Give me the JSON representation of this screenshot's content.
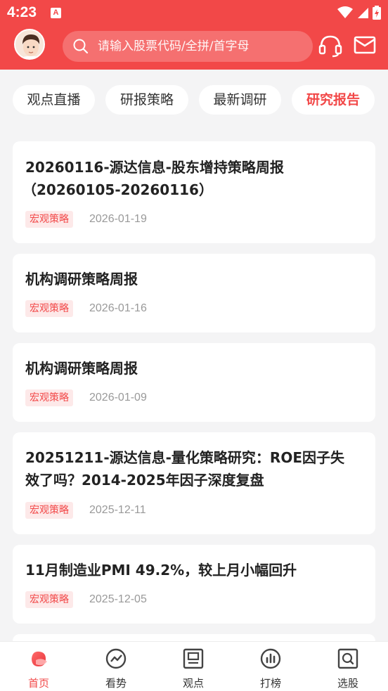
{
  "status_bar": {
    "time": "4:23",
    "notif_badge": "A"
  },
  "header": {
    "search_placeholder": "请输入股票代码/全拼/首字母",
    "icons": [
      "user-avatar",
      "search-icon",
      "headset-icon",
      "mail-icon"
    ]
  },
  "tabs": [
    {
      "label": "观点直播",
      "active": false
    },
    {
      "label": "研报策略",
      "active": false
    },
    {
      "label": "最新调研",
      "active": false
    },
    {
      "label": "研究报告",
      "active": true
    }
  ],
  "reports": [
    {
      "title_line1": "20260116-源达信息-股东增持策略周报",
      "title_line2": "（20260105-20260116）",
      "tag": "宏观策略",
      "date": "2026-01-19"
    },
    {
      "title_line1": "机构调研策略周报",
      "tag": "宏观策略",
      "date": "2026-01-16"
    },
    {
      "title_line1": "机构调研策略周报",
      "tag": "宏观策略",
      "date": "2026-01-09"
    },
    {
      "title_line1": "20251211-源达信息-量化策略研究：ROE因子失",
      "title_line2": "效了吗？2014-2025年因子深度复盘",
      "tag": "宏观策略",
      "date": "2025-12-11"
    },
    {
      "title_line1": "11月制造业PMI 49.2%，较上月小幅回升",
      "tag": "宏观策略",
      "date": "2025-12-05"
    }
  ],
  "bottom_nav": [
    {
      "label": "首页",
      "icon": "home-icon",
      "active": true
    },
    {
      "label": "看势",
      "icon": "trend-icon",
      "active": false
    },
    {
      "label": "观点",
      "icon": "viewpoint-icon",
      "active": false
    },
    {
      "label": "打榜",
      "icon": "ranking-icon",
      "active": false
    },
    {
      "label": "选股",
      "icon": "stock-picker-icon",
      "active": false
    }
  ],
  "colors": {
    "brand": "#f24848",
    "tag_bg": "#fde9e9",
    "page_bg": "#f4f4f5"
  }
}
